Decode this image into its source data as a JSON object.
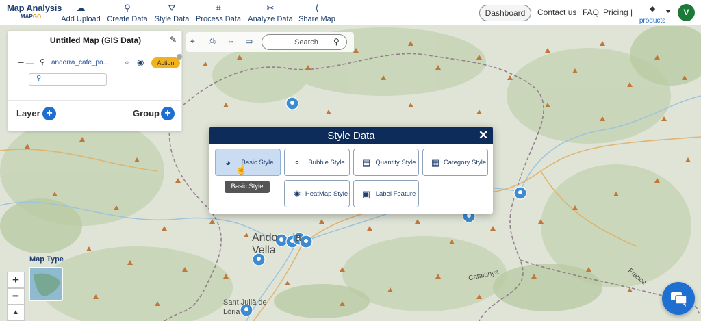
{
  "brand": {
    "title": "Map Analysis",
    "sub_prefix": "MAP",
    "sub_suffix": "GO"
  },
  "nav": [
    {
      "label": "Add Upload",
      "icon": "cloud-upload-icon"
    },
    {
      "label": "Create Data",
      "icon": "pin-icon"
    },
    {
      "label": "Style Data",
      "icon": "paint-bucket-icon"
    },
    {
      "label": "Process Data",
      "icon": "process-icon"
    },
    {
      "label": "Analyze Data",
      "icon": "analyze-icon"
    },
    {
      "label": "Share Map",
      "icon": "share-icon"
    }
  ],
  "topright": {
    "dashboard": "Dashboard",
    "contact": "Contact us",
    "faq": "FAQ",
    "pricing": "Pricing |",
    "products": "products",
    "avatar_initial": "V"
  },
  "layer_panel": {
    "title": "Untitled Map (GIS Data)",
    "layer_name": "andorra_cafe_po...",
    "action_label": "Action",
    "layer_label": "Layer",
    "group_label": "Group"
  },
  "toolbar": {
    "search_placeholder": "Search"
  },
  "modal": {
    "title": "Style Data",
    "options_row1": [
      {
        "label": "Basic Style",
        "icon": "globe-style-icon",
        "active": true
      },
      {
        "label": "Bubble Style",
        "icon": "bubble-icon",
        "active": false
      },
      {
        "label": "Quantity Style",
        "icon": "quantity-icon",
        "active": false
      },
      {
        "label": "Category Style",
        "icon": "category-grid-icon",
        "active": false
      }
    ],
    "options_row2": [
      {
        "label": "HeatMap Style",
        "icon": "heatmap-icon",
        "active": false
      },
      {
        "label": "Label Feature",
        "icon": "label-icon",
        "active": false
      }
    ],
    "tooltip": "Basic Style"
  },
  "map": {
    "map_type_label": "Map Type",
    "place_labels": [
      "Andorra la Vella",
      "Sant Julià de Lòria",
      "Catalunya",
      "France"
    ],
    "colors": {
      "nav_blue": "#1f3f6e",
      "accent": "#1e6fcf",
      "action": "#f0b21d",
      "modal_header": "#0d2c5a"
    }
  },
  "zoom": {
    "in": "+",
    "out": "−",
    "north": "▲"
  }
}
